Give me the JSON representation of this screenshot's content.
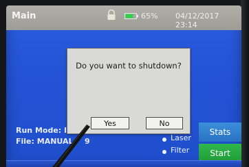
{
  "status_bar": {
    "title": "Main",
    "battery_percent": "65%",
    "datetime": "04/12/2017 23:14",
    "icons": [
      "lock-icon",
      "battery-icon"
    ],
    "battery_color": "#2fd14b"
  },
  "info": {
    "run_mode_label": "Run Mode: I",
    "file_label": "File: MANUAL",
    "file_suffix": "9"
  },
  "legend": {
    "items": [
      "Laser",
      "Filter"
    ]
  },
  "buttons": {
    "stats_label": "Stats",
    "start_label": "Start"
  },
  "dialog": {
    "message": "Do you want to shutdown?",
    "yes_label": "Yes",
    "no_label": "No"
  },
  "colors": {
    "screen_bg": "#2454d6",
    "dialog_bg": "#d9d9d7",
    "stats_button": "#3b8fd9",
    "start_button": "#1f9a36"
  }
}
